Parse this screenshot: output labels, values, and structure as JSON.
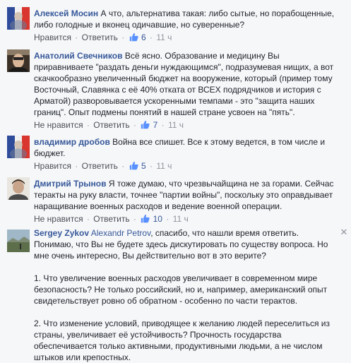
{
  "comments": [
    {
      "author": "Алексей Мосин",
      "text": "А что, альтернатива такая: либо сытые, но порабощенные, либо голодные и вконец одичавшие, но суверенные?",
      "like_label": "Нравится",
      "reply_label": "Ответить",
      "likes": "6",
      "time": "11 ч"
    },
    {
      "author": "Анатолий Свечников",
      "text": "Всё ясно. Образование и медицину Вы приравниваете \"раздать деньги нуждающимся\", подразумевая нищих, а вот скачкообразно увеличенный бюджет на вооружение, который (пример тому Восточный, Славянка с её 40% отката от ВСЕХ подрядчиков и история с Арматой) разворовывается ускоренными темпами - это \"защита наших границ\". Опыт подмены понятий в нашей стране усвоен на \"пять\".",
      "like_label": "Не нравится",
      "reply_label": "Ответить",
      "likes": "7",
      "time": "11 ч"
    },
    {
      "author": "владимир дробов",
      "text": "Война все спишет. Все к этому ведется, в том числе и бюджет.",
      "like_label": "Нравится",
      "reply_label": "Ответить",
      "likes": "5",
      "time": "11 ч"
    },
    {
      "author": "Дмитрий Трынов",
      "text": "Я тоже думаю, что чрезвычайщина не за горами. Сейчас теракты на руку власти, точнее \"партии войны\", поскольку это оправдывает наращивание военных расходов и ведение военной операции.",
      "like_label": "Не нравится",
      "reply_label": "Ответить",
      "likes": "10",
      "time": "11 ч"
    },
    {
      "author": "Sergey Zykov",
      "mention": "Alexandr Petrov",
      "text": ", спасибо, что нашли время ответить. Понимаю, что Вы не будете здесь дискутировать по существу вопроса. Но мне очень интересно, Вы действительно вот в это верите?",
      "para1": "1. Что увеличение военных расходов увеличивает в современном мире безопасность? Не только российский, но и, например, американский опыт свидетельствует ровно об обратном - особенно по части терактов.",
      "para2": "2. Что изменение условий, приводящее к желанию людей переселиться из страны, увеличивает её устойчивость? Прочность государства обеспечивается только активными, продуктивными людьми, а не числом штыков или крепостных.",
      "close_glyph": "✕"
    }
  ],
  "separator": "·",
  "colors": {
    "link": "#365899",
    "meta": "#90949c",
    "text": "#1d2129"
  }
}
